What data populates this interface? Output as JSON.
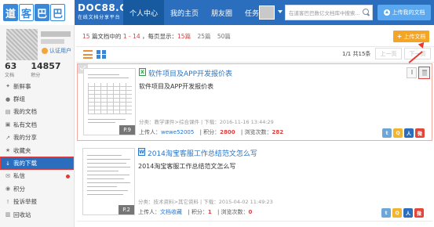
{
  "header": {
    "logo_chars": [
      "道",
      "客",
      "巴",
      "巴"
    ],
    "brand_name": "DOC88.COM",
    "brand_tagline": "在线文档分享平台",
    "nav": [
      "个人中心",
      "我的主页",
      "朋友圈",
      "任务"
    ],
    "search_placeholder": "在道客巴巴数亿文档库中搜索...",
    "upload_label": "上传我的文档"
  },
  "sidebar": {
    "verified_label": "认证用户",
    "stats": [
      {
        "value": "63",
        "label": "文档"
      },
      {
        "value": "14857",
        "label": "积分"
      }
    ],
    "menu": [
      {
        "label": "新鲜事",
        "icon": "megaphone-icon",
        "glyph": "✦"
      },
      {
        "label": "群组",
        "icon": "group-icon",
        "glyph": "●"
      },
      {
        "label": "我的文档",
        "icon": "document-icon",
        "glyph": "▤"
      },
      {
        "label": "私有文档",
        "icon": "lock-icon",
        "glyph": "▣"
      },
      {
        "label": "我的分享",
        "icon": "share-icon",
        "glyph": "↗"
      },
      {
        "label": "收藏夹",
        "icon": "star-icon",
        "glyph": "★"
      },
      {
        "label": "我的下载",
        "icon": "download-icon",
        "glyph": "↓"
      },
      {
        "label": "私信",
        "icon": "mail-icon",
        "glyph": "✉"
      },
      {
        "label": "积分",
        "icon": "coin-icon",
        "glyph": "◉"
      },
      {
        "label": "投诉举报",
        "icon": "report-icon",
        "glyph": "!"
      },
      {
        "label": "回收站",
        "icon": "trash-icon",
        "glyph": "▥"
      }
    ],
    "active_item": "我的下载"
  },
  "toolbar": {
    "summary_prefix": "15",
    "summary_mid": "篇文档中的",
    "summary_range": "1 - 14",
    "summary_perpage_label": "，每页显示：",
    "summary_perpage_value": "15",
    "summary_perpage_unit": "篇",
    "perpage_options": [
      "25篇",
      "50篇"
    ],
    "batch_upload_label": "上传文档",
    "pager_info": "1/1 共15条",
    "prev_label": "上一页",
    "next_label": "下一页"
  },
  "documents": [
    {
      "title": "软件项目及APP开发报价表",
      "description": "软件项目及APP开发报价表",
      "meta": "分类：教学课件>综合课件 | 下载：2016-11-16 13:44:29",
      "uploader_label": "上传人：",
      "uploader": "wewe52005",
      "points_label": "积分：",
      "points": "2800",
      "views_label": "浏览次数：",
      "views": "282",
      "pages": "P.9",
      "type_glyph": "X"
    },
    {
      "title": "2014淘宝客服工作总结范文怎么写",
      "description": "2014淘宝客服工作总结范文怎么写",
      "meta": "分类：技术资料>其它资料 | 下载：2015-04-02 11:49:23",
      "uploader_label": "上传人：",
      "uploader": "文档收藏",
      "points_label": "积分：",
      "points": "1",
      "views_label": "浏览次数：",
      "views": "0",
      "pages": "P.2",
      "type_glyph": "W"
    }
  ],
  "share_buttons": [
    {
      "name": "tencent-weibo-icon",
      "glyph": "t",
      "color": "#6fa6d9"
    },
    {
      "name": "qzone-icon",
      "glyph": "Q",
      "color": "#f2b531"
    },
    {
      "name": "renren-icon",
      "glyph": "人",
      "color": "#2a6ebd"
    },
    {
      "name": "sina-weibo-icon",
      "glyph": "微",
      "color": "#e2483a"
    }
  ],
  "colors": {
    "brand_blue": "#2a6ebd",
    "accent_red": "#e23c3c",
    "accent_orange": "#f3a528"
  }
}
